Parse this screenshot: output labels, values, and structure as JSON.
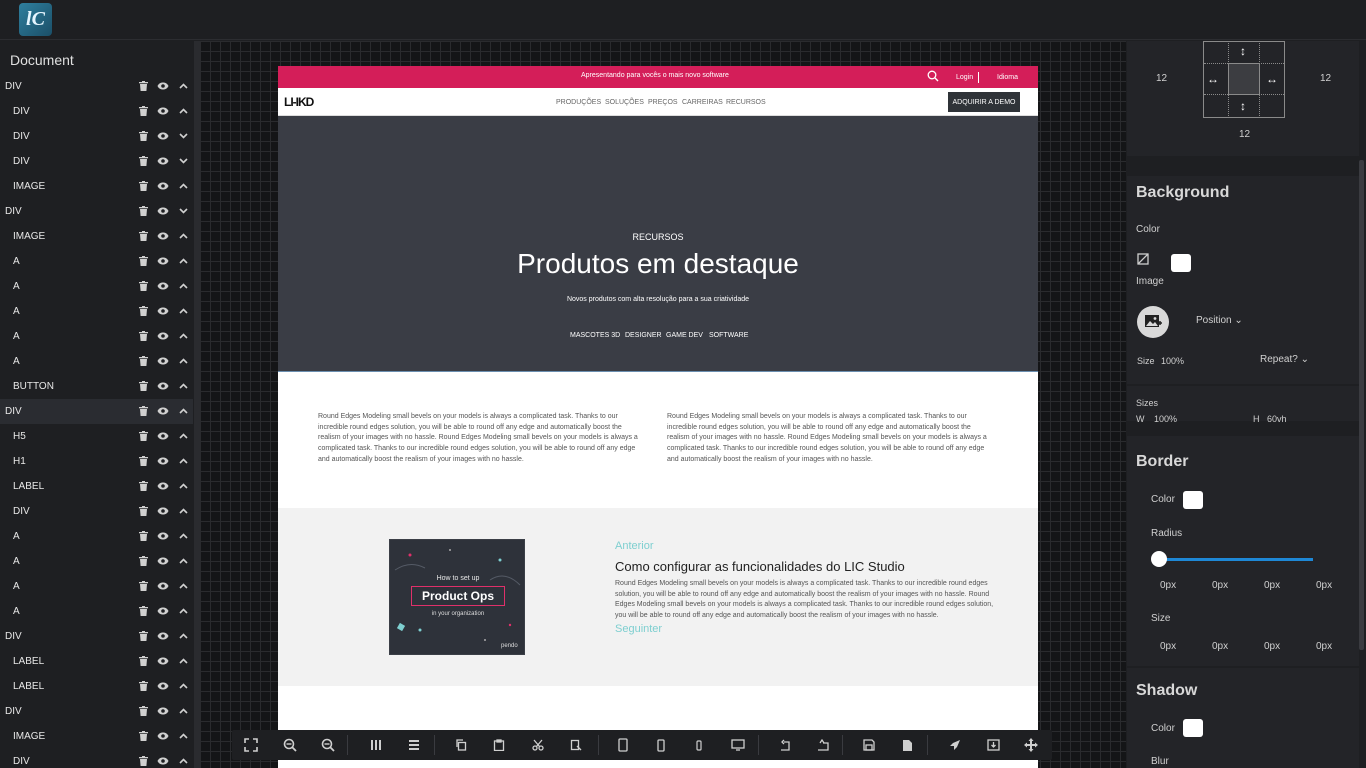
{
  "app": {
    "logo_text": "lC"
  },
  "left_panel": {
    "title": "Document",
    "layers": [
      {
        "label": "DIV",
        "indent": 0,
        "chevron": "up"
      },
      {
        "label": "DIV",
        "indent": 1,
        "chevron": "up"
      },
      {
        "label": "DIV",
        "indent": 1,
        "chevron": "down"
      },
      {
        "label": "DIV",
        "indent": 1,
        "chevron": "down"
      },
      {
        "label": "IMAGE",
        "indent": 1,
        "chevron": "up"
      },
      {
        "label": "DIV",
        "indent": 0,
        "chevron": "down"
      },
      {
        "label": "IMAGE",
        "indent": 1,
        "chevron": "up"
      },
      {
        "label": "A",
        "indent": 1,
        "chevron": "up"
      },
      {
        "label": "A",
        "indent": 1,
        "chevron": "up"
      },
      {
        "label": "A",
        "indent": 1,
        "chevron": "up"
      },
      {
        "label": "A",
        "indent": 1,
        "chevron": "up"
      },
      {
        "label": "A",
        "indent": 1,
        "chevron": "up"
      },
      {
        "label": "BUTTON",
        "indent": 1,
        "chevron": "up"
      },
      {
        "label": "DIV",
        "indent": 0,
        "chevron": "up",
        "selected": true
      },
      {
        "label": "H5",
        "indent": 1,
        "chevron": "up"
      },
      {
        "label": "H1",
        "indent": 1,
        "chevron": "up"
      },
      {
        "label": "LABEL",
        "indent": 1,
        "chevron": "up"
      },
      {
        "label": "DIV",
        "indent": 1,
        "chevron": "up"
      },
      {
        "label": "A",
        "indent": 1,
        "chevron": "up"
      },
      {
        "label": "A",
        "indent": 1,
        "chevron": "up"
      },
      {
        "label": "A",
        "indent": 1,
        "chevron": "up"
      },
      {
        "label": "A",
        "indent": 1,
        "chevron": "up"
      },
      {
        "label": "DIV",
        "indent": 0,
        "chevron": "up"
      },
      {
        "label": "LABEL",
        "indent": 1,
        "chevron": "up"
      },
      {
        "label": "LABEL",
        "indent": 1,
        "chevron": "up"
      },
      {
        "label": "DIV",
        "indent": 0,
        "chevron": "up"
      },
      {
        "label": "IMAGE",
        "indent": 1,
        "chevron": "up"
      },
      {
        "label": "DIV",
        "indent": 1,
        "chevron": "up"
      }
    ]
  },
  "site": {
    "announcement": "Apresentando para vocês o mais novo software",
    "login": "Login",
    "language": "Idioma",
    "logo_text": "LI-IKD",
    "nav": [
      "PRODUÇÕES",
      "SOLUÇÕES",
      "PREÇOS",
      "CARREIRAS",
      "RECURSOS"
    ],
    "demo_button": "ADQUIRIR A DEMO",
    "hero": {
      "kicker": "RECURSOS",
      "title": "Produtos em destaque",
      "subtitle": "Novos produtos com alta resolução para a sua criatividade",
      "links": [
        "MASCOTES 3D",
        "DESIGNER",
        "GAME DEV",
        "SOFTWARE"
      ]
    },
    "text_col_left": "Round Edges Modeling small bevels on your models is always a complicated task. Thanks to our incredible round edges solution, you will be able to round off any edge and automatically boost the realism of your images with no hassle. Round Edges Modeling small bevels on your models is always a complicated task. Thanks to our incredible round edges solution, you will be able to round off any edge and automatically boost the realism of your images with no hassle.",
    "text_col_right": "Round Edges Modeling small bevels on your models is always a complicated task. Thanks to our incredible round edges solution, you will be able to round off any edge and automatically boost the realism of your images with no hassle. Round Edges Modeling small bevels on your models is always a complicated task. Thanks to our incredible round edges solution, you will be able to round off any edge and automatically boost the realism of your images with no hassle.",
    "feature": {
      "prev": "Anterior",
      "title": "Como configurar as funcionalidades do LIC Studio",
      "body": "Round Edges Modeling small bevels on your models is always a complicated task. Thanks to our incredible round edges solution, you will be able to round off any edge and automatically boost the realism of your images with no hassle. Round Edges Modeling small bevels on your models is always a complicated task. Thanks to our incredible round edges solution, you will be able to round off any edge and automatically boost the realism of your images with no hassle.",
      "next": "Seguinter",
      "image": {
        "line1": "How to set up",
        "line2": "Product Ops",
        "line3": "in your organization",
        "brand": "pendo"
      }
    }
  },
  "toolbar": {
    "icons": [
      "fullscreen-icon",
      "zoom-in-icon",
      "zoom-out-icon",
      "columns-icon",
      "rows-icon",
      "copy-icon",
      "paste-icon",
      "cut-icon",
      "paste-style-icon",
      "tablet-icon",
      "mobile-icon",
      "mobile-small-icon",
      "desktop-icon",
      "undo-icon",
      "redo-icon",
      "save-icon",
      "document-icon",
      "publish-icon",
      "download-icon",
      "move-icon"
    ]
  },
  "right_panel": {
    "spacing": {
      "left": "12",
      "right": "12",
      "bottom": "12"
    },
    "background": {
      "title": "Background",
      "color_label": "Color",
      "image_label": "Image",
      "position_label": "Position",
      "size_label": "Size",
      "size_value": "100%",
      "repeat_label": "Repeat?",
      "sizes_label": "Sizes",
      "w_label": "W",
      "w_value": "100%",
      "h_label": "H",
      "h_value": "60vh"
    },
    "border": {
      "title": "Border",
      "color_label": "Color",
      "radius_label": "Radius",
      "radius_values": [
        "0px",
        "0px",
        "0px",
        "0px"
      ],
      "size_label": "Size",
      "size_values": [
        "0px",
        "0px",
        "0px",
        "0px"
      ]
    },
    "shadow": {
      "title": "Shadow",
      "color_label": "Color",
      "blur_label": "Blur"
    }
  }
}
